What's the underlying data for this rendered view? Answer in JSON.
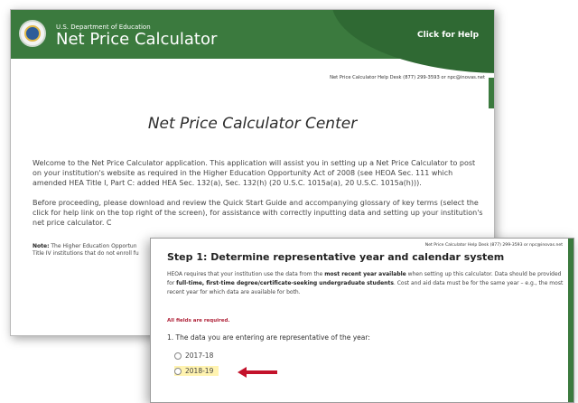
{
  "back_window": {
    "header": {
      "agency": "U.S. Department of Education",
      "title": "Net Price Calculator",
      "help_link": "Click for Help"
    },
    "helpdesk": "Net Price Calculator Help Desk (877) 299-3593 or npc@inovas.net",
    "page_title": "Net Price Calculator Center",
    "paragraph1": "Welcome to the Net Price Calculator application. This application will assist you in setting up a Net Price Calculator to post on your institution's website as required in the Higher Education Opportunity Act of 2008 (see HEOA Sec. 111 which amended HEA Title I, Part C: added HEA Sec. 132(a), Sec. 132(h) (20 U.S.C. 1015a(a), 20 U.S.C. 1015a(h))).",
    "paragraph2": "Before proceeding, please download and review the Quick Start Guide and accompanying glossary of key terms (select the click for help link on the top right of the screen), for assistance with correctly inputting data and setting up your institution's net price calculator. C",
    "note_label": "Note:",
    "note_text": " The Higher Education Opportun",
    "note_text2": "Title IV institutions that do not enroll fu"
  },
  "front_window": {
    "helpdesk": "Net Price Calculator Help Desk (877) 299-3593 or npc@inovas.net",
    "step_title": "Step 1: Determine representative year and calendar system",
    "body_part1": "HEOA requires that your institution use the data from the ",
    "body_bold1": "most recent year available",
    "body_part2": " when setting up this calculator. Data should be provided for ",
    "body_bold2": "full-time, first-time degree/certificate-seeking undergraduate students",
    "body_part3": ". Cost and aid data must be for the same year – e.g., the most recent year for which data are available for both.",
    "required_note": "All fields are required.",
    "question": "1. The data you are entering are representative of the year:",
    "options": [
      "2017-18",
      "2018-19"
    ],
    "highlighted_option": "2018-19"
  },
  "colors": {
    "header_green": "#3b7a3e",
    "required_red": "#b0243a",
    "arrow_red": "#c3122b",
    "highlight_yellow": "#fff3b0"
  },
  "icons": {
    "seal": "department-seal-icon",
    "arrow": "red-arrow-icon"
  }
}
